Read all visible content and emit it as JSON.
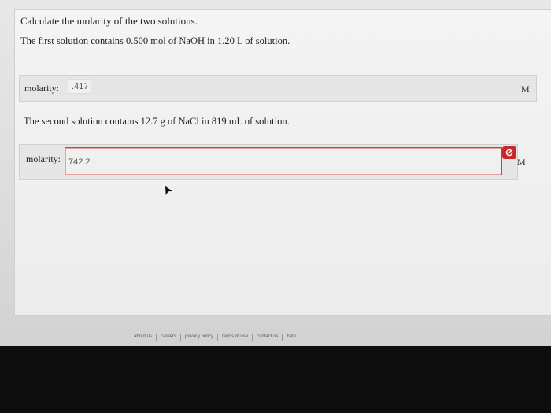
{
  "question": {
    "title": "Calculate the molarity of the two solutions.",
    "part1": "The first solution contains 0.500 mol of NaOH in 1.20 L of solution.",
    "part2": "The second solution contains 12.7 g of NaCl in 819 mL of solution."
  },
  "answers": [
    {
      "label": "molarity:",
      "value": ".417",
      "unit": "M",
      "status": "ok"
    },
    {
      "label": "molarity:",
      "value": "742.2",
      "unit": "M",
      "status": "incorrect",
      "status_icon": "error-circle-slash-icon"
    }
  ],
  "colors": {
    "error": "#c82828",
    "panel": "#ececec"
  },
  "footer": {
    "links": [
      "about us",
      "careers",
      "privacy policy",
      "terms of use",
      "contact us",
      "help"
    ]
  }
}
